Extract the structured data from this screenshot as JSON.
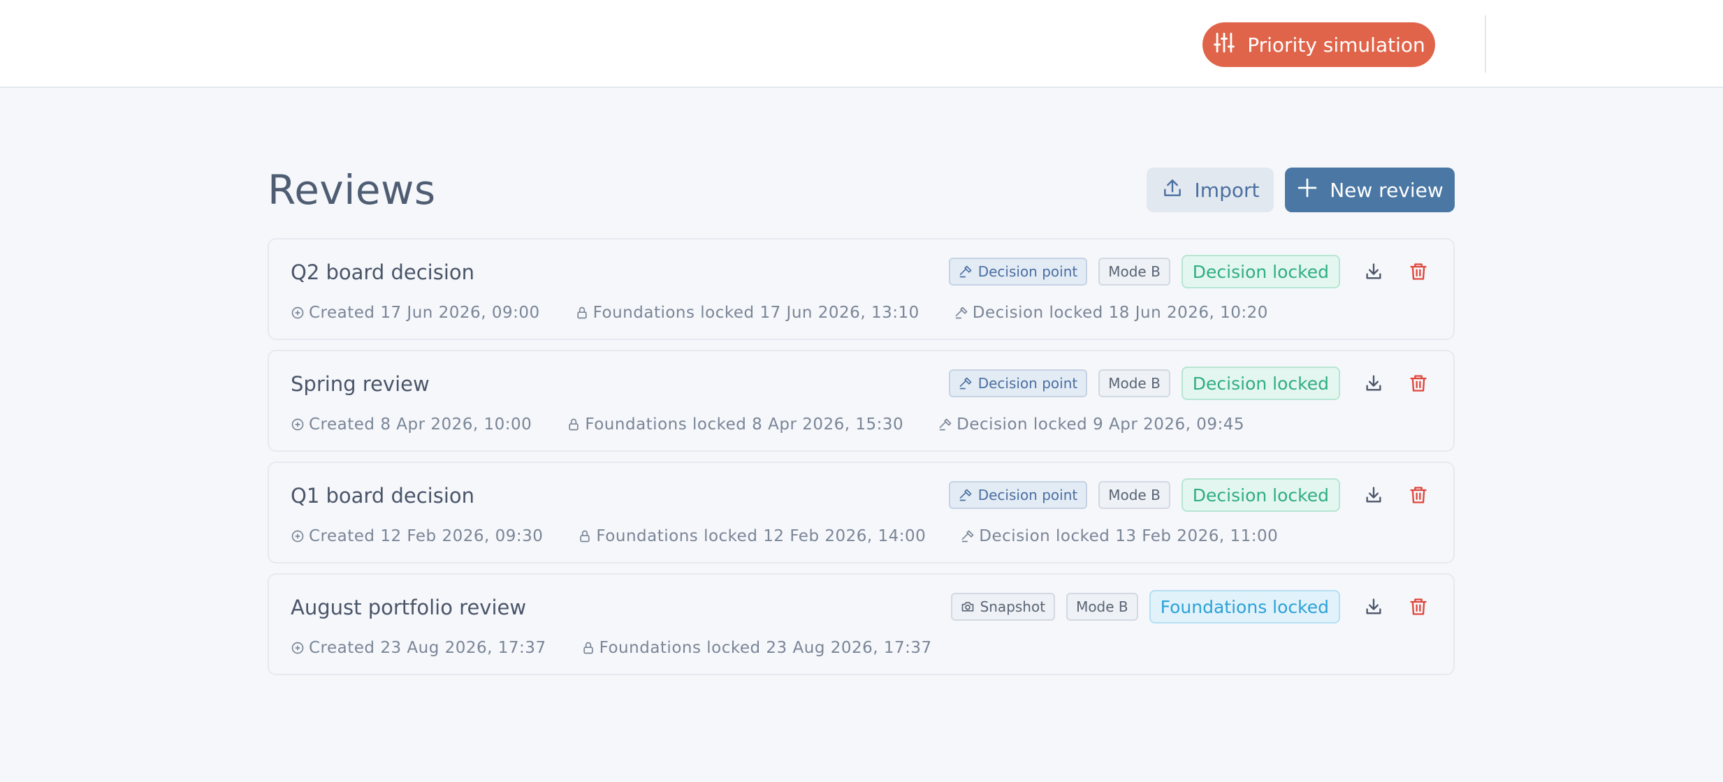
{
  "header": {
    "priority_button": "Priority simulation"
  },
  "page": {
    "title": "Reviews",
    "import_label": "Import",
    "new_review_label": "New review"
  },
  "reviews": [
    {
      "name": "Q2 board decision",
      "tag": "Decision point",
      "mode": "Mode B",
      "status": "Decision locked",
      "created": "Created 17 Jun 2026, 09:00",
      "foundations": "Foundations locked 17 Jun 2026, 13:10",
      "decision": "Decision locked 18 Jun 2026, 10:20"
    },
    {
      "name": "Spring review",
      "tag": "Decision point",
      "mode": "Mode B",
      "status": "Decision locked",
      "created": "Created 8 Apr 2026, 10:00",
      "foundations": "Foundations locked 8 Apr 2026, 15:30",
      "decision": "Decision locked 9 Apr 2026, 09:45"
    },
    {
      "name": "Q1 board decision",
      "tag": "Decision point",
      "mode": "Mode B",
      "status": "Decision locked",
      "created": "Created 12 Feb 2026, 09:30",
      "foundations": "Foundations locked 12 Feb 2026, 14:00",
      "decision": "Decision locked 13 Feb 2026, 11:00"
    },
    {
      "name": "August portfolio review",
      "tag": "Snapshot",
      "mode": "Mode B",
      "status": "Foundations locked",
      "created": "Created 23 Aug 2026, 17:37",
      "foundations": "Foundations locked 23 Aug 2026, 17:37",
      "decision": ""
    }
  ],
  "colors": {
    "accent": "#e0644a",
    "primary": "#4a77a3",
    "decision_locked": "#2fae82",
    "foundations_locked": "#2ba2d6",
    "delete": "#e0453a"
  },
  "icons": {
    "priority": "sliders-icon",
    "import": "upload-icon",
    "new": "plus-icon",
    "created": "plus-circle-icon",
    "foundations": "lock-icon",
    "decision": "gavel-icon",
    "snapshot": "camera-icon",
    "download": "download-icon",
    "delete": "trash-icon"
  }
}
